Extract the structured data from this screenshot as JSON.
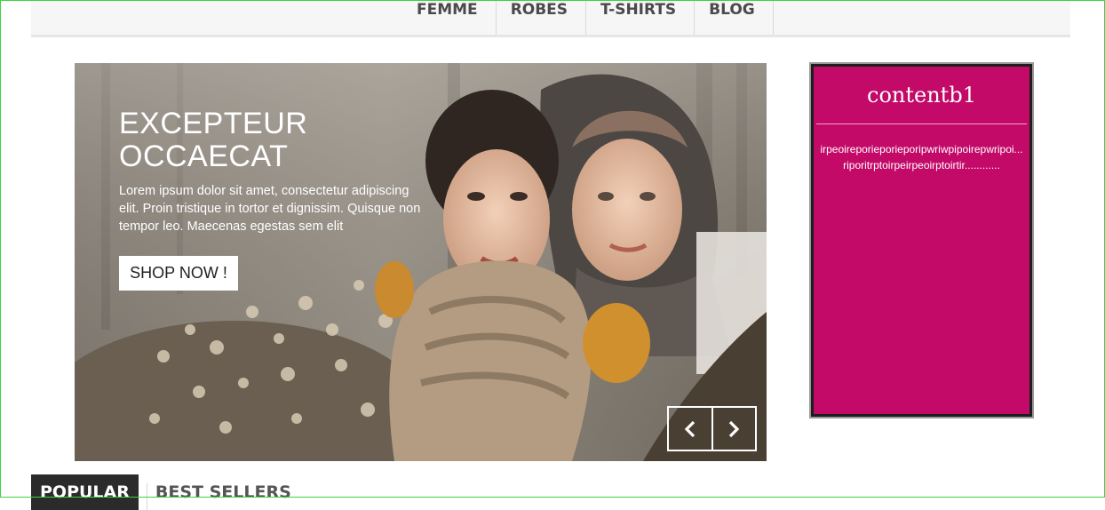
{
  "nav": {
    "items": [
      {
        "label": "FEMME"
      },
      {
        "label": "ROBES"
      },
      {
        "label": "T-SHIRTS"
      },
      {
        "label": "BLOG"
      }
    ]
  },
  "slider": {
    "title_line1": "EXCEPTEUR",
    "title_line2": "OCCAECAT",
    "text": "Lorem ipsum dolor sit amet, consectetur adipiscing elit. Proin tristique in tortor et dignissim. Quisque non tempor leo. Maecenas egestas sem elit",
    "button_label": "SHOP NOW !",
    "prev_icon": "chevron-left-icon",
    "next_icon": "chevron-right-icon"
  },
  "block": {
    "title": "contentb1",
    "text_line1": "irpeoireporieporieporipwriwpipoirepwripoi...",
    "text_line2": "riporitrptoirpeirpeoirptoirtir............",
    "background": "#c30a68"
  },
  "tabs": {
    "items": [
      {
        "label": "POPULAR"
      },
      {
        "label": "BEST SELLERS"
      }
    ]
  }
}
